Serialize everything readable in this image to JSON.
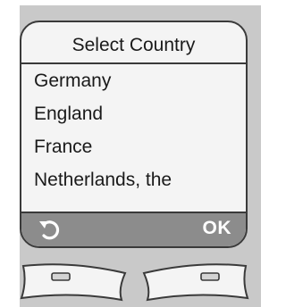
{
  "screen": {
    "title": "Select Country",
    "items": [
      {
        "label": "Germany"
      },
      {
        "label": "England"
      },
      {
        "label": "France"
      },
      {
        "label": "Netherlands, the"
      }
    ]
  },
  "softkeys": {
    "left_icon": "back-arrow-icon",
    "right_label": "OK"
  },
  "colors": {
    "device_body": "#c9c9c9",
    "screen_background": "#f4f4f4",
    "softkey_bar": "#8c8c8c",
    "outline": "#3a3a3a"
  }
}
